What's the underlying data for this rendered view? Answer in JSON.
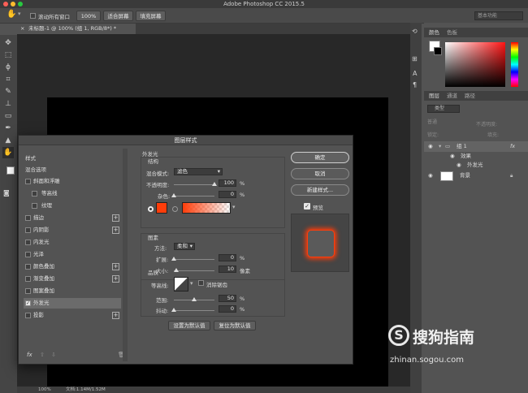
{
  "app_title": "Adobe Photoshop CC 2015.5",
  "options_bar": {
    "scroll_all_label": "滚动所有窗口",
    "zoom_value": "100%",
    "fit_screen_label": "适合屏幕",
    "fill_screen_label": "填充屏幕",
    "workspace_placeholder": "基本功能"
  },
  "doc_tab": {
    "title": "未标题-1 @ 100% (组 1, RGB/8*) *",
    "close": "×"
  },
  "status_bar": {
    "zoom": "100%",
    "doc_info": "文档:1.14M/1.52M"
  },
  "color_panel": {
    "tabs": [
      "颜色",
      "色板"
    ]
  },
  "layers_panel": {
    "tabs": [
      "图层",
      "通道",
      "路径"
    ],
    "kind_filter": "类型",
    "blend_mode": "普通",
    "opacity_label": "不透明度:",
    "lock_label": "锁定:",
    "fill_label": "填充:",
    "layers": [
      {
        "name": "组 1",
        "fx": "fx"
      },
      {
        "name": "效果"
      },
      {
        "name": "外发光"
      },
      {
        "name": "背景"
      }
    ]
  },
  "dialog": {
    "title": "图层样式",
    "style_list": {
      "header_styles": "样式",
      "header_blend": "混合选项",
      "items": [
        {
          "label": "斜面和浮雕",
          "checked": false,
          "plus": false
        },
        {
          "label": "等高线",
          "checked": false,
          "plus": false,
          "indent": true
        },
        {
          "label": "纹理",
          "checked": false,
          "plus": false,
          "indent": true
        },
        {
          "label": "描边",
          "checked": false,
          "plus": true
        },
        {
          "label": "内阴影",
          "checked": false,
          "plus": true
        },
        {
          "label": "内发光",
          "checked": false,
          "plus": false
        },
        {
          "label": "光泽",
          "checked": false,
          "plus": false
        },
        {
          "label": "颜色叠加",
          "checked": false,
          "plus": true
        },
        {
          "label": "渐变叠加",
          "checked": false,
          "plus": true
        },
        {
          "label": "图案叠加",
          "checked": false,
          "plus": false
        },
        {
          "label": "外发光",
          "checked": true,
          "plus": false,
          "selected": true
        },
        {
          "label": "投影",
          "checked": false,
          "plus": true
        }
      ],
      "fx_label": "fx"
    },
    "outer_glow": {
      "title": "外发光",
      "structure_title": "结构",
      "blend_mode_label": "混合模式:",
      "blend_mode_value": "滤色",
      "opacity_label": "不透明度:",
      "opacity_value": "100",
      "noise_label": "杂色:",
      "noise_value": "0",
      "percent": "%",
      "glow_color": "#ff3d0a",
      "elements_title": "图素",
      "method_label": "方法:",
      "method_value": "柔和",
      "spread_label": "扩展:",
      "spread_value": "0",
      "size_label": "大小:",
      "size_value": "10",
      "pixels": "像素",
      "quality_title": "品质",
      "contour_label": "等高线:",
      "antialias_label": "消除锯齿",
      "range_label": "范围:",
      "range_value": "50",
      "jitter_label": "抖动:",
      "jitter_value": "0",
      "set_default": "设置为默认值",
      "reset_default": "复位为默认值"
    },
    "buttons": {
      "ok": "确定",
      "cancel": "取消",
      "new_style": "新建样式...",
      "preview": "预览"
    }
  },
  "watermark": {
    "brand": "搜狗指南",
    "url": "zhinan.sogou.com"
  }
}
